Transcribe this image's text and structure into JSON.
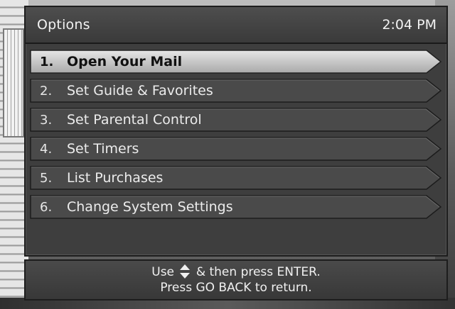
{
  "header": {
    "title": "Options",
    "time": "2:04 PM"
  },
  "menu": {
    "selected_index": 0,
    "items": [
      {
        "number": "1.",
        "label": "Open Your Mail"
      },
      {
        "number": "2.",
        "label": "Set Guide & Favorites"
      },
      {
        "number": "3.",
        "label": "Set Parental Control"
      },
      {
        "number": "4.",
        "label": "Set Timers"
      },
      {
        "number": "5.",
        "label": "List Purchases"
      },
      {
        "number": "6.",
        "label": "Change System Settings"
      }
    ]
  },
  "footer": {
    "line1_before": "Use",
    "line1_icon": "up-down-arrows-icon",
    "line1_after": "& then press ENTER.",
    "line2": "Press GO BACK to return."
  },
  "colors": {
    "panel": "#3e3e3e",
    "item": "#4a4a4a",
    "item_selected": "#c8c8c8",
    "text": "#ececec"
  }
}
